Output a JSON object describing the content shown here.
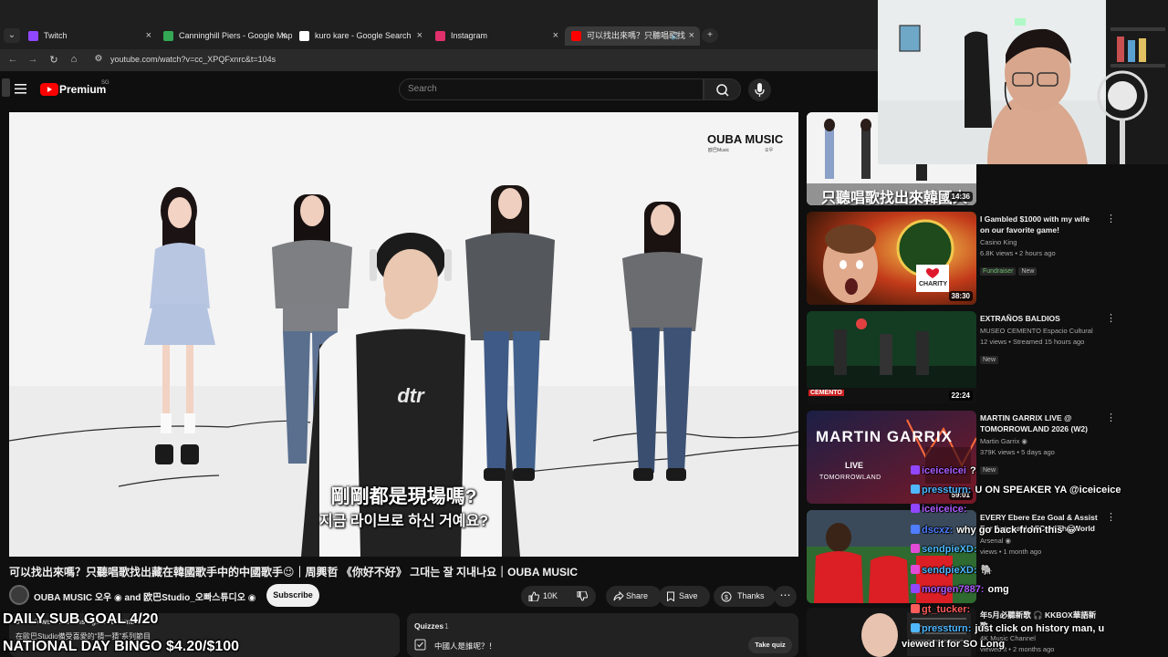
{
  "browser": {
    "tabs": [
      {
        "title": "Twitch",
        "active": false,
        "favicon": "twitch-icon",
        "color": "#9146ff"
      },
      {
        "title": "Canninghill Piers - Google Maps",
        "active": false,
        "favicon": "google-maps-icon",
        "color": "#34a853"
      },
      {
        "title": "kuro kare - Google Search",
        "active": false,
        "favicon": "google-icon",
        "color": "#ffffff"
      },
      {
        "title": "Instagram",
        "active": false,
        "favicon": "instagram-icon",
        "color": "#e1306c"
      },
      {
        "title": "可以找出來嗎？只聽唱歌找",
        "active": true,
        "favicon": "youtube-icon",
        "color": "#ff0000"
      }
    ],
    "url": "youtube.com/watch?v=cc_XPQFxnrc&t=104s"
  },
  "youtube": {
    "logo_text": "Premium",
    "logo_region": "SG",
    "search_placeholder": "Search",
    "video": {
      "watermark": "OUBA MUSIC",
      "watermark_sub": "欧巴Music",
      "watermark_sub_right": "오우",
      "subtitle_zh": "剛剛都是現場嗎?",
      "subtitle_ko": "지금 라이브로 하신 거예요?",
      "shirt_text": "dtr"
    },
    "title": "可以找出來嗎？只聽唱歌找出藏在韓國歌手中的中國歌手😉｜周興哲 《你好不好》 그대는 잘 지내나요｜OUBA MUSIC",
    "channel": "OUBA MUSIC 오우 ◉ and 欧巴Studio_오빠스튜디오 ◉",
    "subscribe": "Subscribe",
    "actions": {
      "likes": "10K",
      "share": "Share",
      "save": "Save",
      "thanks": "Thanks"
    },
    "description_views": "85K views  2 months ago  #oubamusic",
    "description_text": "在歐巴Studio備受喜愛的“猜一猜”系列節目",
    "quiz": {
      "header": "Quizzes",
      "count": "1",
      "question": "中國人是誰呢？！",
      "button": "Take quiz"
    }
  },
  "recommendations": [
    {
      "title": "",
      "channel": "",
      "meta": "",
      "duration": "14:36",
      "thumb_text": "只聽唱歌找出來韓國人",
      "badges": []
    },
    {
      "title": "I Gambled $1000 with my wife on our favorite game!",
      "channel": "Casino King",
      "meta": "6.8K views • 2 hours ago",
      "duration": "38:30",
      "thumb_text": "CHARITY",
      "badges": [
        "Fundraiser",
        "New"
      ]
    },
    {
      "title": "EXTRAÑOS BALDIOS",
      "channel": "MUSEO CEMENTO Espacio Cultural",
      "meta": "12 views • Streamed 15 hours ago",
      "duration": "22:24",
      "thumb_text": "CEMENTO",
      "badges": [
        "New"
      ]
    },
    {
      "title": "MARTIN GARRIX LIVE @ TOMORROWLAND 2026 (W2)",
      "channel": "Martin Garrix ◉",
      "meta": "379K views • 5 days ago",
      "duration": "59:01",
      "thumb_text": "MARTIN GARRIX",
      "thumb_sub": "LIVE",
      "thumb_sub2": "TOMORROWLAND",
      "badges": [
        "New"
      ]
    },
    {
      "title": "EVERY Ebere Eze Goal & Assist For Arsenal | AFC At The World",
      "channel": "Arsenal ◉",
      "meta": "views • 1 month ago",
      "duration": "",
      "thumb_text": "",
      "badges": []
    },
    {
      "title": "年5月必聽新歌 🎧 KKBOX華語新歌",
      "channel": "4K Music Channel",
      "meta": "viewed it • 2 months ago",
      "duration": "",
      "thumb_text": "",
      "badges": []
    }
  ],
  "chat": [
    {
      "name": "iceiceicei",
      "message": "?",
      "color": "#b05cff"
    },
    {
      "name": "pressturn:",
      "message": "U ON SPEAKER YA @iceiceice",
      "color": "#4fb7ff"
    },
    {
      "name": "iceiceice:",
      "message": "",
      "color": "#b05cff"
    },
    {
      "name": "dscxz:",
      "message": "why go back from this 😂",
      "color": "#4f7dff"
    },
    {
      "name": "sendpieXD:",
      "message": "",
      "color": "#4fb7ff"
    },
    {
      "name": "sendpieXD:",
      "message": "🐘",
      "color": "#4fb7ff"
    },
    {
      "name": "morgen7887:",
      "message": "omg",
      "color": "#b05cff"
    },
    {
      "name": "gt_tucker:",
      "message": "",
      "color": "#ff5c5c"
    },
    {
      "name": "pressturn:",
      "message": "just click on history man, u",
      "color": "#4fb7ff"
    },
    {
      "name": "",
      "message": "viewed it for SO Long",
      "color": "#ffffff"
    }
  ],
  "overlay": {
    "goal_line1": "DAILY SUB GOAL 4/20",
    "goal_line2": "NATIONAL DAY BINGO $4.20/$100"
  }
}
